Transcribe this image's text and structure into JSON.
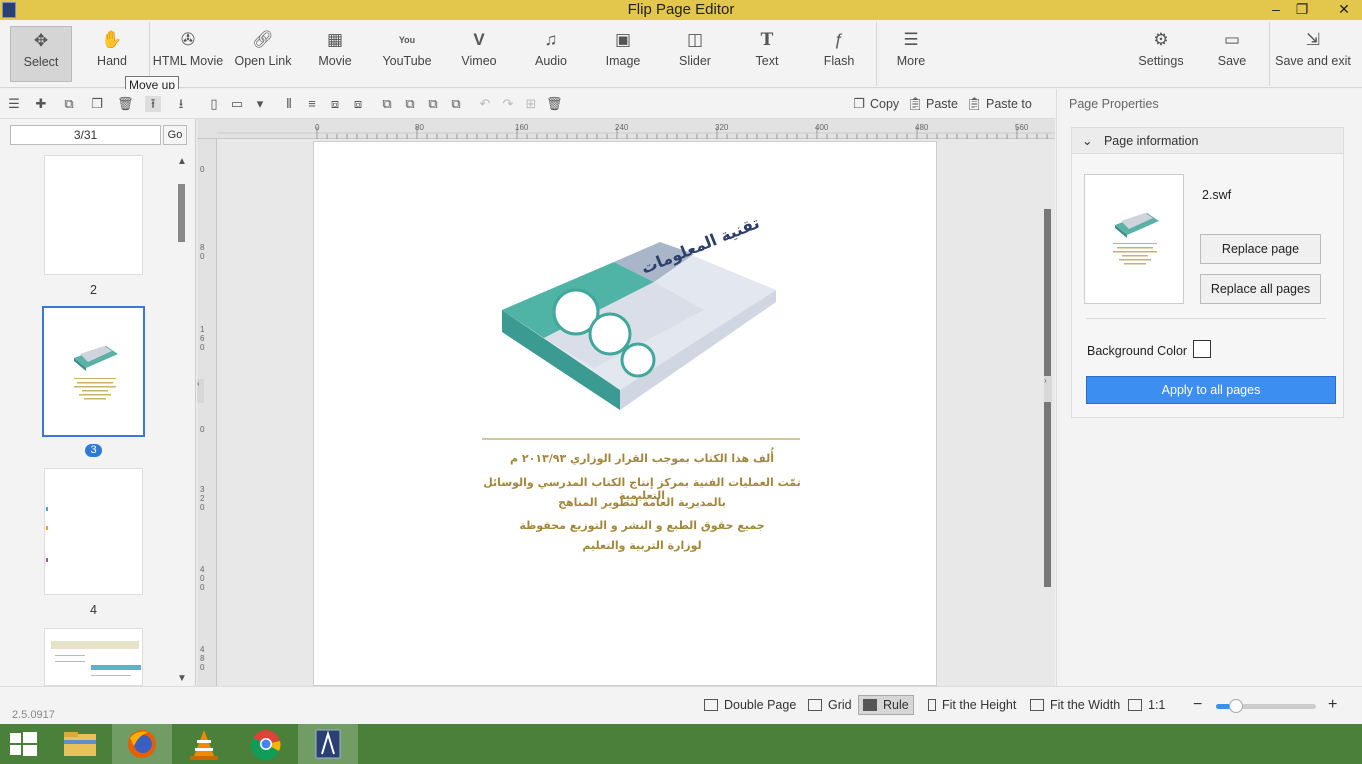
{
  "window": {
    "title": "Flip Page Editor",
    "controls": [
      "–",
      "❐",
      "✕"
    ]
  },
  "toolbar": {
    "items": [
      {
        "label": "Select",
        "icon": "select-icon"
      },
      {
        "label": "Hand",
        "icon": "hand-icon"
      },
      {
        "label": "HTML Movie",
        "icon": "film-reel-icon"
      },
      {
        "label": "Open Link",
        "icon": "link-icon"
      },
      {
        "label": "Movie",
        "icon": "movie-icon"
      },
      {
        "label": "YouTube",
        "icon": "youtube-icon"
      },
      {
        "label": "Vimeo",
        "icon": "vimeo-icon"
      },
      {
        "label": "Audio",
        "icon": "music-note-icon"
      },
      {
        "label": "Image",
        "icon": "image-icon"
      },
      {
        "label": "Slider",
        "icon": "slider-icon"
      },
      {
        "label": "Text",
        "icon": "text-icon"
      },
      {
        "label": "Flash",
        "icon": "flash-icon"
      },
      {
        "label": "More",
        "icon": "more-icon"
      }
    ],
    "right": [
      {
        "label": "Settings",
        "icon": "gear-icon"
      },
      {
        "label": "Save",
        "icon": "save-icon"
      },
      {
        "label": "Save and exit",
        "icon": "exit-icon"
      }
    ],
    "tooltip": "Move up"
  },
  "subtoolbar": {
    "copy": "Copy",
    "paste": "Paste",
    "paste_to": "Paste to"
  },
  "pages": {
    "current": "3/31",
    "go": "Go",
    "thumbs": [
      {
        "label": "2"
      },
      {
        "label": "3"
      },
      {
        "label": "4"
      }
    ]
  },
  "ruler": {
    "h": [
      "0",
      "80",
      "160",
      "240",
      "320",
      "400",
      "480",
      "560"
    ],
    "v": [
      "0",
      "8\n0",
      "1\n6\n0",
      "0",
      "3\n2\n0",
      "4\n0\n0",
      "4\n8\n0"
    ]
  },
  "book_page": {
    "lines": [
      "أُلف هذا الكتاب بموجب القرار الوزاري ٢٠١٣/٩٣ م",
      "تمّت العمليات الفنية بمركز إنتاج الكتاب المدرسي والوسائل التعليمية",
      "بالمديرية العامة لتطوير المناهج",
      "جميع حقوق الطبع و النشر و التوزيع محفوظة",
      "لوزارة التربية والتعليم"
    ]
  },
  "properties": {
    "title": "Page Properties",
    "section": "Page information",
    "file": "2.swf",
    "replace_page": "Replace page",
    "replace_all": "Replace all pages",
    "bg_color_label": "Background Color",
    "apply_all": "Apply to all pages"
  },
  "statusbar": {
    "version": "2.5.0917",
    "double_page": "Double Page",
    "grid": "Grid",
    "rule": "Rule",
    "fit_height": "Fit the Height",
    "fit_width": "Fit the Width",
    "one_to_one": "1:1",
    "zoom_out": "−",
    "zoom_in": "+",
    "zoom_level": 0.2
  },
  "colors": {
    "titlebar": "#e3c64c",
    "accent": "#3c8ff0",
    "taskbar": "#4a8039",
    "book_text": "#a2873c"
  }
}
